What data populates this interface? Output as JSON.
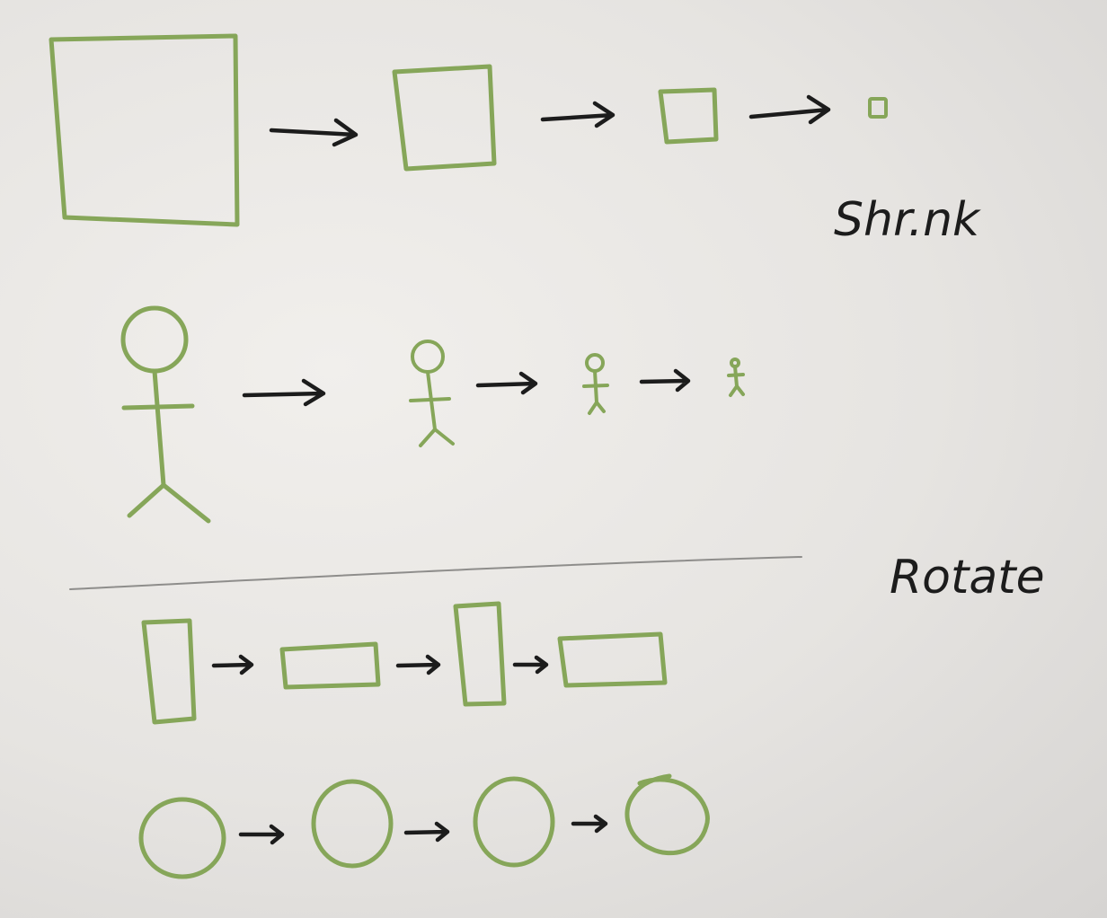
{
  "labels": {
    "shrink": "Shr.nk",
    "rotate": "Rotate"
  },
  "colors": {
    "shape_ink": "#86a659",
    "text_ink": "#1c1c1c",
    "paper": "#e6e4e1"
  }
}
